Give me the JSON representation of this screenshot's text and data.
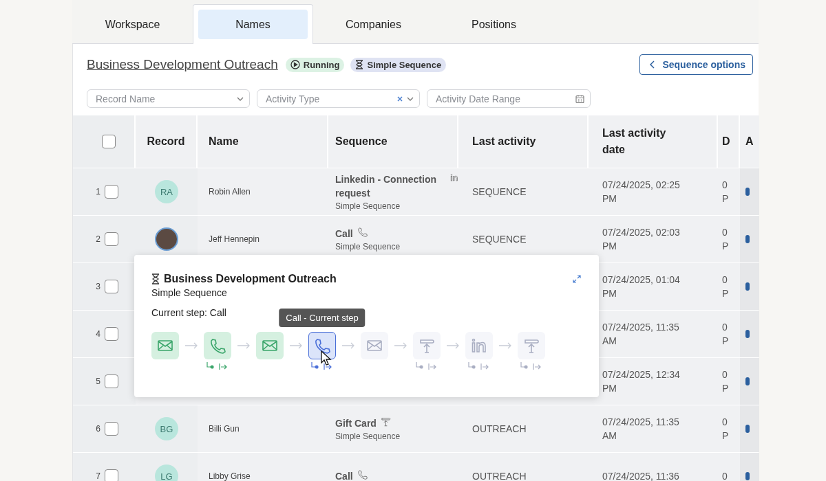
{
  "tabs": [
    {
      "label": "Workspace",
      "selected": false
    },
    {
      "label": "Names",
      "selected": true
    },
    {
      "label": "Companies",
      "selected": false
    },
    {
      "label": "Positions",
      "selected": false
    }
  ],
  "header": {
    "title": "Business Development Outreach",
    "badges": [
      {
        "kind": "status",
        "label": "Running"
      },
      {
        "kind": "type",
        "label": "Simple Sequence"
      }
    ],
    "options_button": "Sequence options"
  },
  "filters": [
    {
      "kind": "select",
      "placeholder": "Record Name",
      "clearable": false
    },
    {
      "kind": "select",
      "placeholder": "Activity Type",
      "clearable": true
    },
    {
      "kind": "date",
      "placeholder": "Activity Date Range",
      "clearable": false
    }
  ],
  "table": {
    "select_all_checked": false,
    "columns": [
      "Record",
      "Name",
      "Sequence",
      "Last activity",
      "Last activity date",
      "D",
      "A"
    ],
    "rows": [
      {
        "number": "1",
        "checked": false,
        "avatar": {
          "kind": "initials",
          "text": "RA"
        },
        "name": "Robin Allen",
        "step": {
          "text": "Linkedin - Connection request",
          "kind": "linkedin"
        },
        "sequence": "Simple Sequence",
        "last_activity": "SEQUENCE",
        "date": "07/24/2025, 02:25 PM",
        "column_6": "0 P"
      },
      {
        "number": "2",
        "checked": false,
        "avatar": {
          "kind": "photo"
        },
        "name": "Jeff Hennepin",
        "step": {
          "text": "Call",
          "kind": "call"
        },
        "sequence": "Simple Sequence",
        "last_activity": "SEQUENCE",
        "date": "07/24/2025, 02:03 PM",
        "column_6": "0 P"
      },
      {
        "number": "3",
        "checked": false,
        "date": "07/24/2025, 01:04 PM",
        "column_6": "0 P"
      },
      {
        "number": "4",
        "checked": false,
        "date": "07/24/2025, 11:35 AM",
        "column_6": "0 P"
      },
      {
        "number": "5",
        "checked": false,
        "date": "07/24/2025, 12:34 PM",
        "column_6": "0 P"
      },
      {
        "number": "6",
        "checked": false,
        "avatar": {
          "kind": "initials",
          "text": "BG"
        },
        "name": "Billi Gun",
        "step": {
          "text": "Gift Card",
          "kind": "gift"
        },
        "sequence": "Simple Sequence",
        "last_activity": "OUTREACH",
        "date": "07/24/2025, 11:35 AM",
        "column_6": "0 P"
      },
      {
        "number": "7",
        "checked": false,
        "avatar": {
          "kind": "initials",
          "text": "LG"
        },
        "name": "Libby Grise",
        "step": {
          "text": "Call",
          "kind": "call"
        },
        "last_activity": "OUTREACH",
        "date": "07/24/2025, 11:36",
        "column_6": "0"
      }
    ]
  },
  "popup": {
    "title": "Business Development Outreach",
    "subtitle": "Simple Sequence",
    "current_step": "Current step: Call",
    "tooltip": "Call - Current step",
    "steps": [
      {
        "kind": "email",
        "completed": true,
        "selected": false,
        "branch": false
      },
      {
        "kind": "call",
        "completed": true,
        "selected": false,
        "branch": true
      },
      {
        "kind": "email",
        "completed": true,
        "selected": false,
        "branch": false
      },
      {
        "kind": "call",
        "completed": false,
        "selected": true,
        "branch": true
      },
      {
        "kind": "email",
        "completed": false,
        "selected": false,
        "branch": false
      },
      {
        "kind": "gift",
        "completed": false,
        "selected": false,
        "branch": true
      },
      {
        "kind": "linkedin",
        "completed": false,
        "selected": false,
        "branch": true
      },
      {
        "kind": "gift",
        "completed": false,
        "selected": false,
        "branch": true
      }
    ]
  }
}
